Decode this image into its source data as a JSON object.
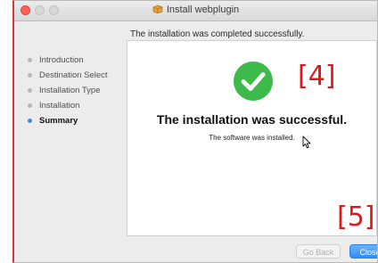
{
  "window": {
    "title": "Install webplugin",
    "header_message": "The installation was completed successfully."
  },
  "sidebar": {
    "steps": [
      {
        "label": "Introduction",
        "active": false
      },
      {
        "label": "Destination Select",
        "active": false
      },
      {
        "label": "Installation Type",
        "active": false
      },
      {
        "label": "Installation",
        "active": false
      },
      {
        "label": "Summary",
        "active": true
      }
    ]
  },
  "content": {
    "icon": "checkmark-circle-icon",
    "title": "The installation was successful.",
    "subtitle": "The software was installed."
  },
  "annotations": {
    "a4": "[4]",
    "a5": "[5]"
  },
  "buttons": {
    "go_back": "Go Back",
    "close": "Close"
  },
  "colors": {
    "accent": "#2f8df6",
    "success": "#3dbb4a",
    "annotation": "#e01818"
  }
}
